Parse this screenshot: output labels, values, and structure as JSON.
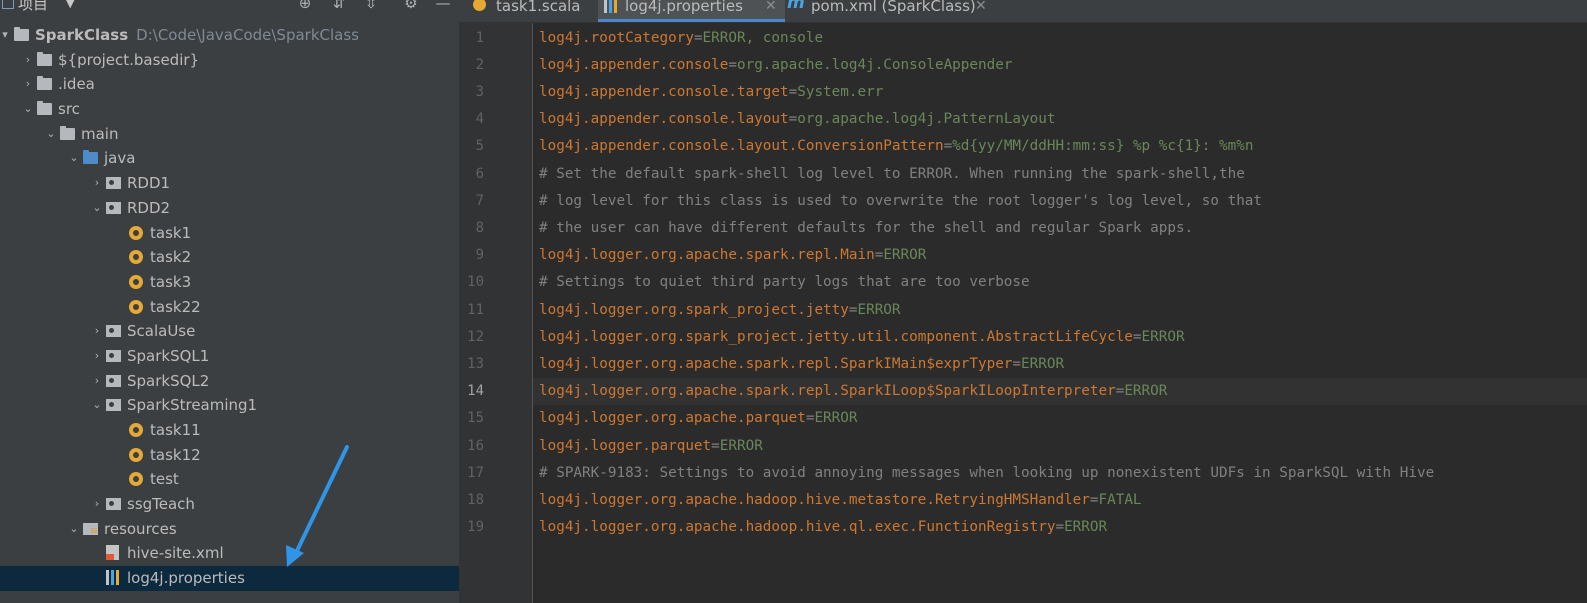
{
  "project_panel": {
    "title": "项目",
    "tree": [
      {
        "label": "SparkClass",
        "path": "D:\\Code\\JavaCode\\SparkClass",
        "icon": "folder-icon",
        "depth": 0,
        "arrow": "▾"
      },
      {
        "label": "${project.basedir}",
        "icon": "folder-icon",
        "depth": 1,
        "arrow": "›"
      },
      {
        "label": ".idea",
        "icon": "folder-icon",
        "depth": 1,
        "arrow": "›"
      },
      {
        "label": "src",
        "icon": "folder-icon",
        "depth": 1,
        "arrow": "⌄"
      },
      {
        "label": "main",
        "icon": "folder-icon",
        "depth": 2,
        "arrow": "⌄"
      },
      {
        "label": "java",
        "icon": "source-folder-icon",
        "depth": 3,
        "arrow": "⌄"
      },
      {
        "label": "RDD1",
        "icon": "package-icon",
        "depth": 4,
        "arrow": "›"
      },
      {
        "label": "RDD2",
        "icon": "package-icon",
        "depth": 4,
        "arrow": "⌄"
      },
      {
        "label": "task1",
        "icon": "scala-object-icon",
        "depth": 5,
        "arrow": ""
      },
      {
        "label": "task2",
        "icon": "scala-object-icon",
        "depth": 5,
        "arrow": ""
      },
      {
        "label": "task3",
        "icon": "scala-object-icon",
        "depth": 5,
        "arrow": ""
      },
      {
        "label": "task22",
        "icon": "scala-object-icon",
        "depth": 5,
        "arrow": ""
      },
      {
        "label": "ScalaUse",
        "icon": "package-icon",
        "depth": 4,
        "arrow": "›"
      },
      {
        "label": "SparkSQL1",
        "icon": "package-icon",
        "depth": 4,
        "arrow": "›"
      },
      {
        "label": "SparkSQL2",
        "icon": "package-icon",
        "depth": 4,
        "arrow": "›"
      },
      {
        "label": "SparkStreaming1",
        "icon": "package-icon",
        "depth": 4,
        "arrow": "⌄"
      },
      {
        "label": "task11",
        "icon": "scala-object-icon",
        "depth": 5,
        "arrow": ""
      },
      {
        "label": "task12",
        "icon": "scala-object-icon",
        "depth": 5,
        "arrow": ""
      },
      {
        "label": "test",
        "icon": "scala-object-icon",
        "depth": 5,
        "arrow": ""
      },
      {
        "label": "ssgTeach",
        "icon": "package-icon",
        "depth": 4,
        "arrow": "›"
      },
      {
        "label": "resources",
        "icon": "resources-folder-icon",
        "depth": 3,
        "arrow": "⌄"
      },
      {
        "label": "hive-site.xml",
        "icon": "xml-file-icon",
        "depth": 4,
        "arrow": ""
      },
      {
        "label": "log4j.properties",
        "icon": "properties-file-icon",
        "depth": 4,
        "arrow": "",
        "selected": true
      }
    ]
  },
  "tabs": [
    {
      "label": "task1.scala",
      "icon": "scala-object-icon",
      "active": false
    },
    {
      "label": "log4j.properties",
      "icon": "properties-file-icon",
      "active": true
    },
    {
      "label": "pom.xml (SparkClass)",
      "icon": "maven-icon",
      "active": false
    }
  ],
  "editor": {
    "current_line": 14,
    "lines": [
      {
        "n": "1",
        "key": "log4j.rootCategory",
        "value": "ERROR, console"
      },
      {
        "n": "2",
        "key": "log4j.appender.console",
        "value": "org.apache.log4j.ConsoleAppender"
      },
      {
        "n": "3",
        "key": "log4j.appender.console.target",
        "value": "System.err"
      },
      {
        "n": "4",
        "key": "log4j.appender.console.layout",
        "value": "org.apache.log4j.PatternLayout"
      },
      {
        "n": "5",
        "key": "log4j.appender.console.layout.ConversionPattern",
        "value": "%d{yy/MM/ddHH:mm:ss} %p %c{1}: %m%n"
      },
      {
        "n": "6",
        "comment": "# Set the default spark-shell log level to ERROR. When running the spark-shell,the"
      },
      {
        "n": "7",
        "comment": "# log level for this class is used to overwrite the root logger's log level, so that"
      },
      {
        "n": "8",
        "comment": "# the user can have different defaults for the shell and regular Spark apps."
      },
      {
        "n": "9",
        "key": "log4j.logger.org.apache.spark.repl.Main",
        "value": "ERROR"
      },
      {
        "n": "10",
        "comment": "# Settings to quiet third party logs that are too verbose"
      },
      {
        "n": "11",
        "key": "log4j.logger.org.spark_project.jetty",
        "value": "ERROR"
      },
      {
        "n": "12",
        "key": "log4j.logger.org.spark_project.jetty.util.component.AbstractLifeCycle",
        "value": "ERROR"
      },
      {
        "n": "13",
        "key": "log4j.logger.org.apache.spark.repl.SparkIMain$exprTyper",
        "value": "ERROR"
      },
      {
        "n": "14",
        "key": "log4j.logger.org.apache.spark.repl.SparkILoop$SparkILoopInterpreter",
        "value": "ERROR"
      },
      {
        "n": "15",
        "key": "log4j.logger.org.apache.parquet",
        "value": "ERROR"
      },
      {
        "n": "16",
        "key": "log4j.logger.parquet",
        "value": "ERROR"
      },
      {
        "n": "17",
        "comment": "# SPARK-9183: Settings to avoid annoying messages when looking up nonexistent UDFs in SparkSQL with Hive"
      },
      {
        "n": "18",
        "key": "log4j.logger.org.apache.hadoop.hive.metastore.RetryingHMSHandler",
        "value": "FATAL"
      },
      {
        "n": "19",
        "key": "log4j.logger.org.apache.hadoop.hive.ql.exec.FunctionRegistry",
        "value": "ERROR"
      }
    ]
  },
  "colors": {
    "key": "#cc7832",
    "value": "#6a8759",
    "comment": "#808080",
    "annotation_arrow": "#2f95e8"
  }
}
